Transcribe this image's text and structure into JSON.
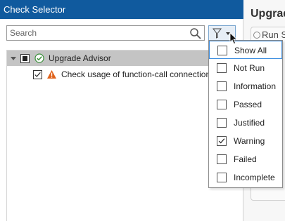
{
  "window": {
    "title": "Check Selector"
  },
  "search": {
    "placeholder": "Search",
    "value": ""
  },
  "filter": {
    "icon": "funnel-icon"
  },
  "tree": {
    "root": {
      "label": "Upgrade Advisor",
      "checkbox_state": "partial",
      "status_icon": "passed-icon"
    },
    "checks": [
      {
        "label": "Check usage of function-call connection",
        "checked": true,
        "status_icon": "warning-icon"
      }
    ]
  },
  "filter_menu": {
    "items": [
      {
        "label": "Show All",
        "checked": false,
        "highlighted": true
      },
      {
        "label": "Not Run",
        "checked": false
      },
      {
        "label": "Information",
        "checked": false
      },
      {
        "label": "Passed",
        "checked": false
      },
      {
        "label": "Justified",
        "checked": false
      },
      {
        "label": "Warning",
        "checked": true
      },
      {
        "label": "Failed",
        "checked": false
      },
      {
        "label": "Incomplete",
        "checked": false
      }
    ]
  },
  "right_panel": {
    "title": "Upgrade",
    "sub": "Run S"
  },
  "colors": {
    "titlebar": "#105a9e",
    "highlight": "#3d8ee0",
    "warning": "#e0621b",
    "passed": "#3a8f3a"
  }
}
